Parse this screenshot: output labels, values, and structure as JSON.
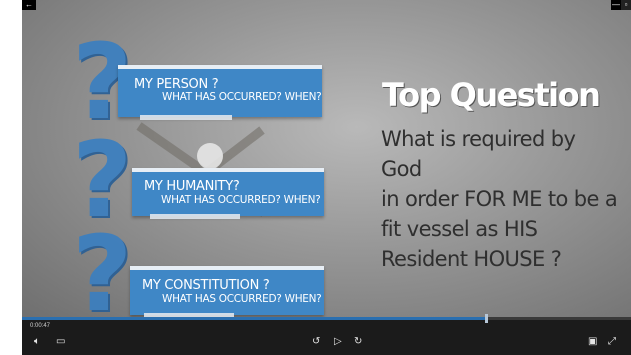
{
  "window": {
    "back_label": "←",
    "minimize_label": "—",
    "restore_label": "▫"
  },
  "slide": {
    "items": [
      {
        "main": "MY PERSON ?",
        "sub": "WHAT HAS OCCURRED? WHEN?"
      },
      {
        "main": "MY HUMANITY?",
        "sub": "WHAT HAS OCCURRED? WHEN?"
      },
      {
        "main": "MY CONSTITUTION ?",
        "sub": "WHAT HAS OCCURRED? WHEN?"
      }
    ],
    "question_glyph": "?",
    "headline": "Top Question",
    "question": "What is required by God\nin order FOR ME to be a\nfit vessel as HIS\nResident HOUSE ?",
    "accent_color": "#3f87c6"
  },
  "player": {
    "time": "0:00:47",
    "progress_fraction": 0.76,
    "icons": {
      "volume": "volume-icon",
      "subtitles": "subtitles-icon",
      "rewind": "skip-back-10-icon",
      "play": "play-icon",
      "forward": "skip-forward-30-icon",
      "mini": "mini-view-icon",
      "full": "fullscreen-icon"
    }
  }
}
